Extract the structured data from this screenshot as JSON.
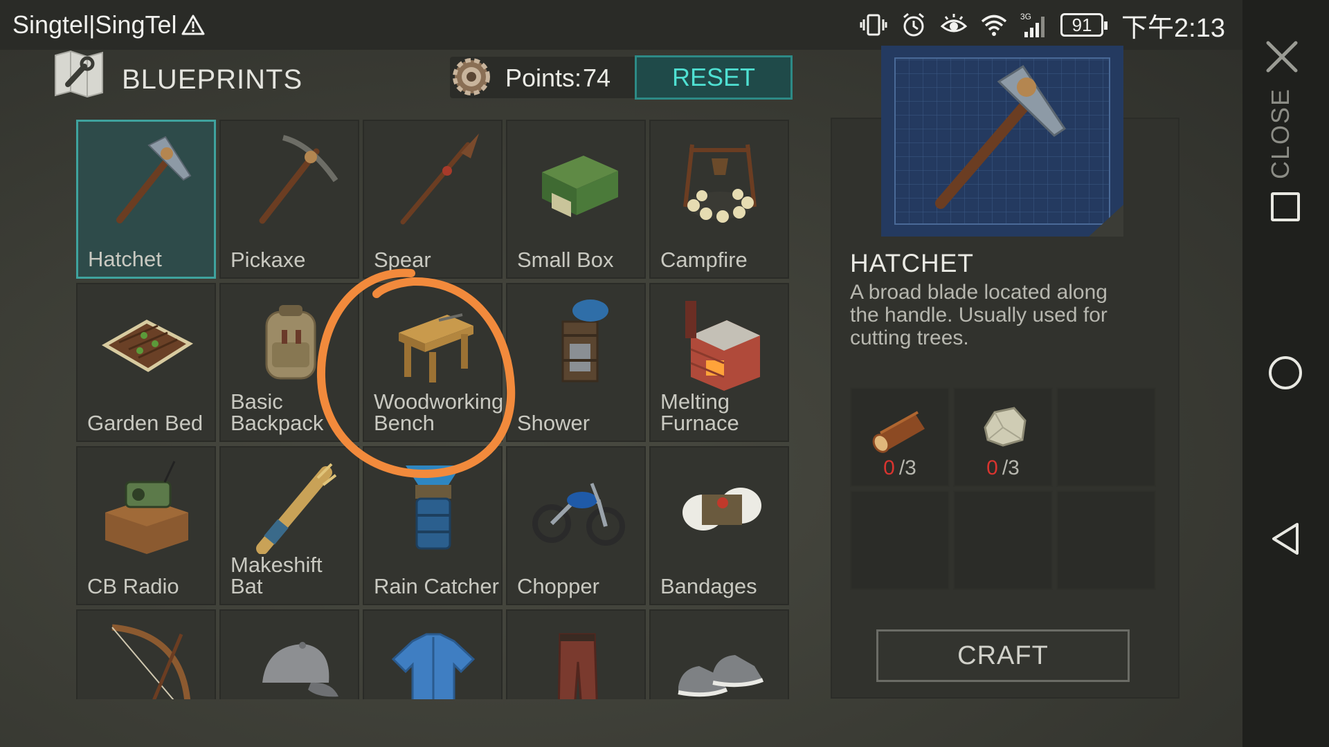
{
  "status_bar": {
    "carrier": "Singtel|SingTel",
    "battery": "91",
    "time": "下午2:13",
    "network": "3G"
  },
  "header": {
    "title": "BLUEPRINTS",
    "points_label": "Points:",
    "points_value": "74",
    "reset_label": "RESET"
  },
  "grid": {
    "items": [
      {
        "label": "Hatchet",
        "icon": "hatchet-icon",
        "selected": true
      },
      {
        "label": "Pickaxe",
        "icon": "pickaxe-icon"
      },
      {
        "label": "Spear",
        "icon": "spear-icon"
      },
      {
        "label": "Small Box",
        "icon": "small-box-icon"
      },
      {
        "label": "Campfire",
        "icon": "campfire-icon"
      },
      {
        "label": "Garden Bed",
        "icon": "garden-bed-icon"
      },
      {
        "label": "Basic\nBackpack",
        "icon": "backpack-icon"
      },
      {
        "label": "Woodworking\nBench",
        "icon": "workbench-icon"
      },
      {
        "label": "Shower",
        "icon": "shower-icon"
      },
      {
        "label": "Melting\nFurnace",
        "icon": "furnace-icon"
      },
      {
        "label": "CB Radio",
        "icon": "radio-icon"
      },
      {
        "label": "Makeshift\nBat",
        "icon": "bat-icon"
      },
      {
        "label": "Rain Catcher",
        "icon": "rain-catcher-icon"
      },
      {
        "label": "Chopper",
        "icon": "motorcycle-icon"
      },
      {
        "label": "Bandages",
        "icon": "bandages-icon"
      },
      {
        "label": "",
        "icon": "bow-icon"
      },
      {
        "label": "",
        "icon": "cap-icon"
      },
      {
        "label": "",
        "icon": "shirt-icon"
      },
      {
        "label": "",
        "icon": "pants-icon"
      },
      {
        "label": "",
        "icon": "sneakers-icon"
      }
    ]
  },
  "detail": {
    "name": "HATCHET",
    "description": "A broad blade located along the handle. Usually used for cutting trees.",
    "ingredients": [
      {
        "icon": "wood-log-icon",
        "have": "0",
        "need": "/3"
      },
      {
        "icon": "stone-icon",
        "have": "0",
        "need": "/3"
      }
    ],
    "craft_label": "CRAFT"
  },
  "side": {
    "close_label": "CLOSE"
  },
  "colors": {
    "accent": "#2d8a86",
    "reset_text": "#4fe0d2",
    "selected_cell": "#2e4b4a",
    "missing_qty": "#d8342f",
    "annotation": "#f28a3c"
  }
}
